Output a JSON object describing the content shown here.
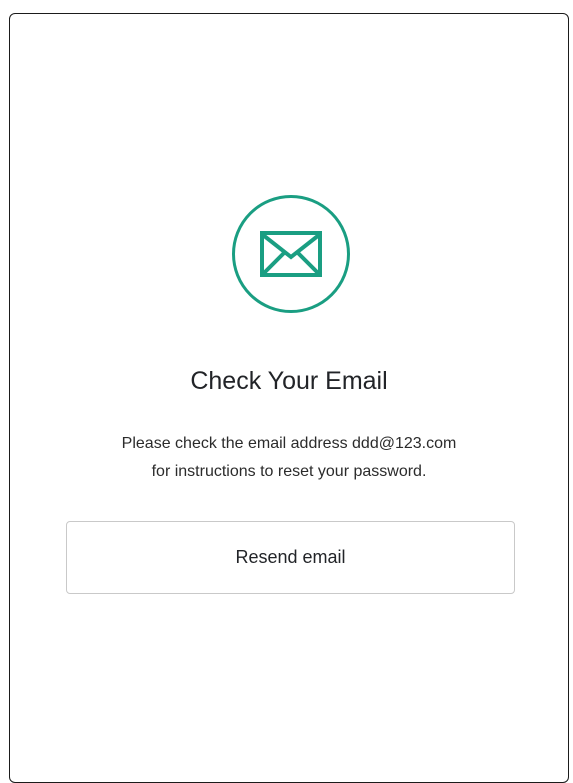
{
  "icon": {
    "name": "envelope-icon",
    "color": "#1a9e82"
  },
  "title": "Check Your Email",
  "message": {
    "line1": "Please check the email address ddd@123.com",
    "line2": "for instructions to reset your password."
  },
  "resend_button": {
    "label": "Resend email"
  }
}
